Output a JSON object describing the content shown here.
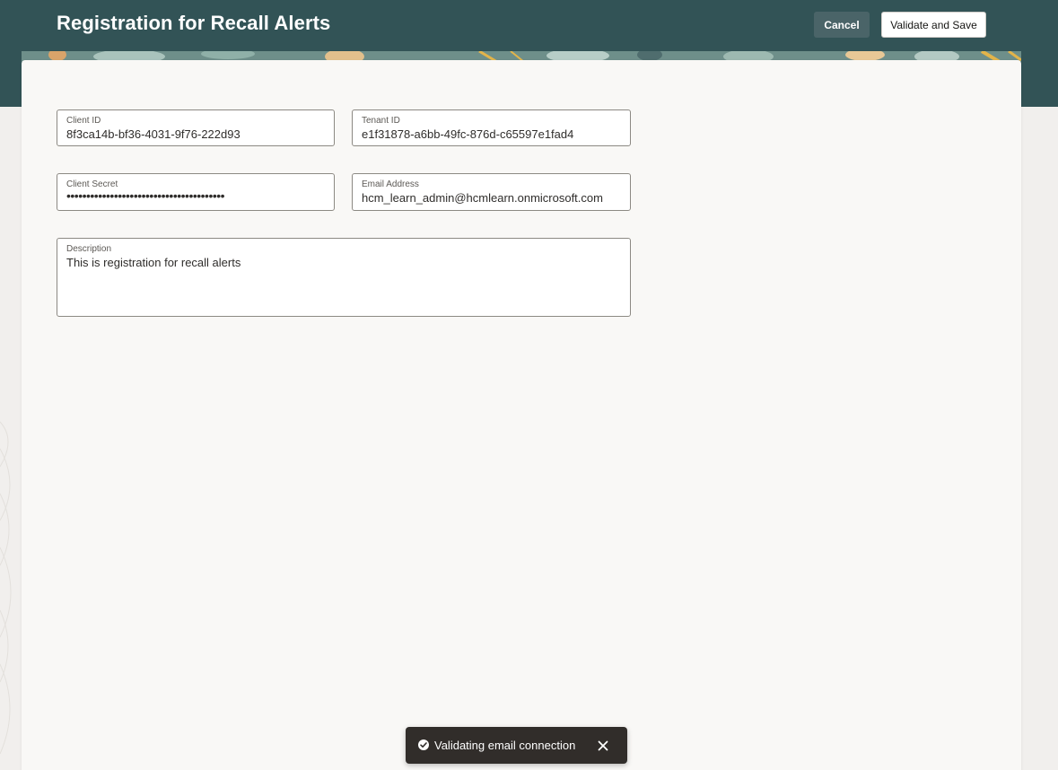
{
  "header": {
    "title": "Registration for Recall Alerts",
    "cancel_label": "Cancel",
    "save_label": "Validate and Save"
  },
  "form": {
    "client_id": {
      "label": "Client ID",
      "value": "8f3ca14b-bf36-4031-9f76-222d93"
    },
    "tenant_id": {
      "label": "Tenant ID",
      "value": "e1f31878-a6bb-49fc-876d-c65597e1fad4"
    },
    "client_secret": {
      "label": "Client Secret",
      "value": "••••••••••••••••••••••••••••••••••••••••"
    },
    "email_address": {
      "label": "Email Address",
      "value": "hcm_learn_admin@hcmlearn.onmicrosoft.com"
    },
    "description": {
      "label": "Description",
      "value": "This is registration for recall alerts"
    }
  },
  "toast": {
    "message": "Validating email connection",
    "icon": "check-circle-icon",
    "close_icon": "close-icon"
  },
  "colors": {
    "header_bg": "#325356",
    "card_bg": "#f9f8f6",
    "toast_bg": "#312d2a"
  }
}
